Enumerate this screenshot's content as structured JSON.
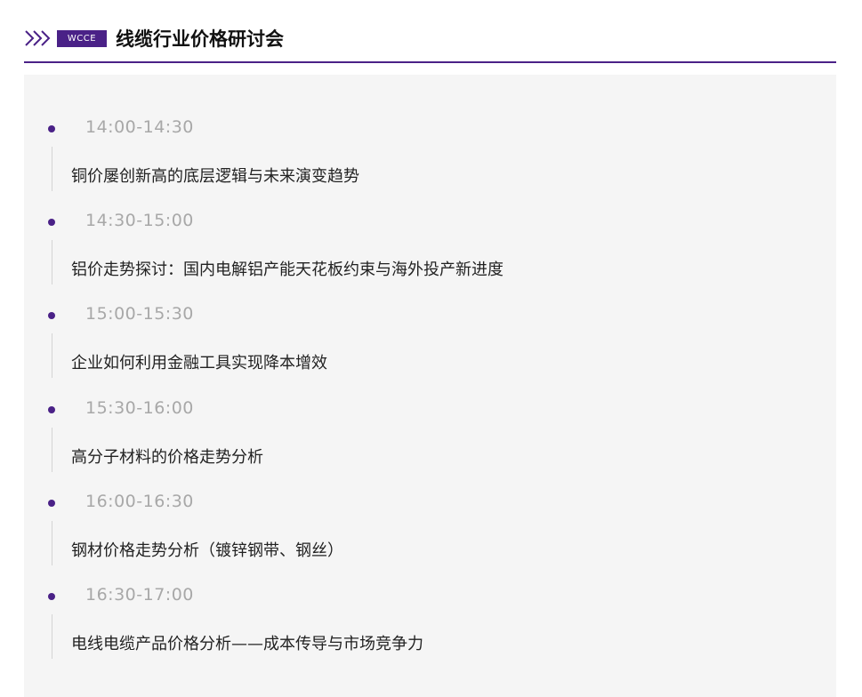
{
  "header": {
    "badge": "WCCE",
    "title": "线缆行业价格研讨会",
    "accent": "#4a2187"
  },
  "schedule": [
    {
      "time": "14:00-14:30",
      "topic": "铜价屡创新高的底层逻辑与未来演变趋势"
    },
    {
      "time": "14:30-15:00",
      "topic": "铝价走势探讨：国内电解铝产能天花板约束与海外投产新进度"
    },
    {
      "time": "15:00-15:30",
      "topic": "企业如何利用金融工具实现降本增效"
    },
    {
      "time": "15:30-16:00",
      "topic": "高分子材料的价格走势分析"
    },
    {
      "time": "16:00-16:30",
      "topic": "钢材价格走势分析（镀锌钢带、钢丝）"
    },
    {
      "time": "16:30-17:00",
      "topic": "电线电缆产品价格分析——成本传导与市场竞争力"
    }
  ]
}
